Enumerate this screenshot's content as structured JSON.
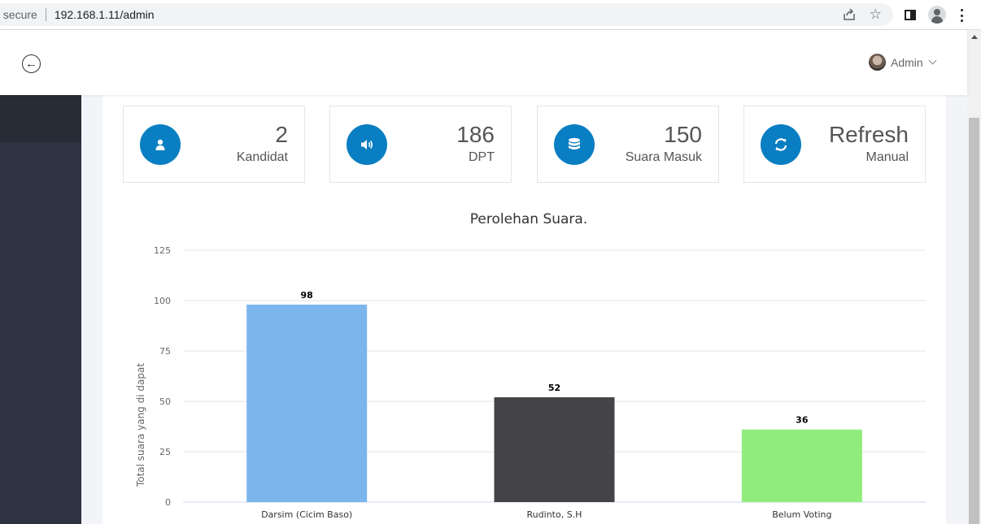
{
  "browser": {
    "security_label": "t secure",
    "url": "192.168.1.11/admin"
  },
  "header": {
    "user_name": "Admin"
  },
  "stats": [
    {
      "icon": "user-icon",
      "value": "2",
      "label": "Kandidat"
    },
    {
      "icon": "volume-icon",
      "value": "186",
      "label": "DPT"
    },
    {
      "icon": "database-icon",
      "value": "150",
      "label": "Suara Masuk"
    },
    {
      "icon": "refresh-icon",
      "value": "Refresh",
      "label": "Manual"
    }
  ],
  "chart_data": {
    "type": "bar",
    "title": "Perolehan Suara.",
    "xlabel": "",
    "ylabel": "Total suara yang di dapat",
    "categories": [
      "Darsim (Cicim Baso)",
      "Rudinto, S.H",
      "Belum Voting"
    ],
    "values": [
      98,
      52,
      36
    ],
    "colors": [
      "#7cb5ec",
      "#434348",
      "#90ed7d"
    ],
    "ylim": [
      0,
      125
    ],
    "yticks": [
      0,
      25,
      50,
      75,
      100,
      125
    ],
    "grid": true,
    "data_labels": true
  }
}
